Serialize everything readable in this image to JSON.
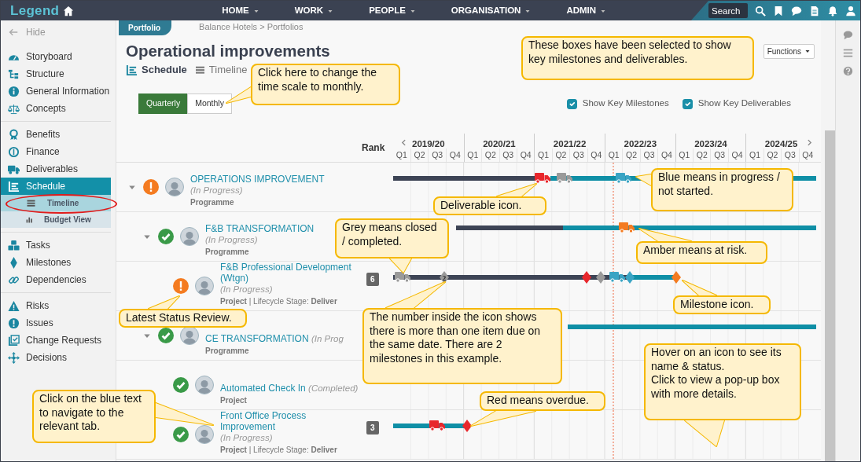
{
  "topbar": {
    "logo": "Legend",
    "menu": [
      {
        "label": "HOME"
      },
      {
        "label": "WORK"
      },
      {
        "label": "PEOPLE"
      },
      {
        "label": "ORGANISATION"
      },
      {
        "label": "ADMIN"
      }
    ],
    "search": {
      "placeholder": "Search"
    }
  },
  "sidebar": {
    "hide": "Hide",
    "groups": [
      {
        "items": [
          {
            "label": "Storyboard",
            "selected": false
          },
          {
            "label": "Structure",
            "selected": false
          },
          {
            "label": "General Information",
            "selected": false
          },
          {
            "label": "Concepts",
            "selected": false
          }
        ]
      },
      {
        "items": [
          {
            "label": "Benefits",
            "selected": false
          },
          {
            "label": "Finance",
            "selected": false
          },
          {
            "label": "Deliverables",
            "selected": false
          },
          {
            "label": "Schedule",
            "selected": true,
            "children": [
              {
                "label": "Timeline",
                "selected": true
              },
              {
                "label": "Budget View",
                "selected": false
              }
            ]
          }
        ]
      },
      {
        "items": [
          {
            "label": "Tasks",
            "selected": false
          },
          {
            "label": "Milestones",
            "selected": false
          },
          {
            "label": "Dependencies",
            "selected": false
          }
        ]
      },
      {
        "items": [
          {
            "label": "Risks",
            "selected": false
          },
          {
            "label": "Issues",
            "selected": false
          },
          {
            "label": "Change Requests",
            "selected": false
          },
          {
            "label": "Decisions",
            "selected": false
          }
        ]
      }
    ]
  },
  "header": {
    "section_tab": "Portfolio",
    "breadcrumb": "Balance Hotels > Portfolios",
    "title": "Operational improvements",
    "functions_button": "Functions",
    "view_tabs": [
      {
        "label": "Schedule",
        "selected": true
      },
      {
        "label": "Timeline",
        "selected": false
      }
    ],
    "scale_toggle": [
      {
        "label": "Quarterly",
        "selected": true
      },
      {
        "label": "Monthly",
        "selected": false
      }
    ],
    "options": [
      {
        "label": "Show Key Milestones",
        "checked": true
      },
      {
        "label": "Show Key Deliverables",
        "checked": true
      }
    ]
  },
  "gantt": {
    "rank_header": "Rank",
    "years": [
      {
        "label": "2019/20",
        "quarters": [
          "Q1",
          "Q2",
          "Q3",
          "Q4"
        ]
      },
      {
        "label": "2020/21",
        "quarters": [
          "Q1",
          "Q2",
          "Q3",
          "Q4"
        ]
      },
      {
        "label": "2021/22",
        "quarters": [
          "Q1",
          "Q2",
          "Q3",
          "Q4"
        ]
      },
      {
        "label": "2022/23",
        "quarters": [
          "Q1",
          "Q2",
          "Q3",
          "Q4"
        ]
      },
      {
        "label": "2023/24",
        "quarters": [
          "Q1",
          "Q2",
          "Q3",
          "Q4"
        ]
      },
      {
        "label": "2024/25",
        "quarters": [
          "Q1",
          "Q2",
          "Q3",
          "Q4"
        ]
      }
    ],
    "rows": [
      {
        "name": "OPERATIONS IMPROVEMENT",
        "state": "(In Progress)",
        "type": "Programme",
        "flagged": true,
        "expanded": true,
        "segments": [
          {
            "color": "#3d4455"
          },
          {
            "color": "#0f8fa6"
          }
        ],
        "markers": [
          {
            "kind": "deliverable",
            "color": "#e8272c"
          },
          {
            "kind": "deliverable",
            "color": "#9a9a9a"
          },
          {
            "kind": "deliverable",
            "color": "#3aa4c4"
          }
        ],
        "children": [
          {
            "name": "F&B TRANSFORMATION",
            "state": "(In Progress)",
            "type": "Programme",
            "flagged": false,
            "expanded": true,
            "segments": [
              {
                "color": "#3d4455"
              },
              {
                "color": "#0f8fa6"
              }
            ],
            "markers": [
              {
                "kind": "deliverable",
                "color": "#f47b20"
              }
            ],
            "children": [
              {
                "name": "F&B Professional Development (Wtgn)",
                "state": "(In Progress)",
                "type": "Project",
                "stage_label": "| Lifecycle Stage:",
                "stage": "Deliver",
                "rank": "6",
                "flagged": true,
                "segments": [
                  {
                    "color": "#3d4455"
                  },
                  {
                    "color": "#0f8fa6"
                  }
                ],
                "markers": [
                  {
                    "kind": "deliverable",
                    "color": "#9a9a9a"
                  },
                  {
                    "kind": "milestone",
                    "color": "#9a9a9a",
                    "count": "2"
                  },
                  {
                    "kind": "milestone",
                    "color": "#e8272c"
                  },
                  {
                    "kind": "milestone",
                    "color": "#9a9a9a"
                  },
                  {
                    "kind": "deliverable",
                    "color": "#3aa4c4"
                  },
                  {
                    "kind": "milestone",
                    "color": "#3aa4c4"
                  },
                  {
                    "kind": "milestone",
                    "color": "#f47b20"
                  }
                ]
              }
            ]
          },
          {
            "name": "CE TRANSFORMATION",
            "state": "(In Prog",
            "type": "Programme",
            "flagged": false,
            "expanded": true,
            "segments": [
              {
                "color": "#0f8fa6"
              }
            ],
            "children": [
              {
                "name": "Automated Check In",
                "state": "(Completed)",
                "type": "Project",
                "flagged": false
              },
              {
                "name": "Front Office Process Improvement",
                "state": "(In Progress)",
                "type": "Project",
                "stage_label": "| Lifecycle Stage:",
                "stage": "Deliver",
                "rank": "3",
                "flagged": false,
                "segments": [
                  {
                    "color": "#0f8fa6"
                  }
                ],
                "markers": [
                  {
                    "kind": "deliverable",
                    "color": "#e8272c"
                  },
                  {
                    "kind": "milestone",
                    "color": "#e8272c"
                  }
                ]
              }
            ]
          }
        ]
      }
    ]
  },
  "annotations": [
    {
      "text": "These boxes have been selected to show key milestones and deliverables."
    },
    {
      "text": "Click here to change the time scale to monthly."
    },
    {
      "text": "Deliverable icon."
    },
    {
      "text": "Blue means in progress / not started."
    },
    {
      "text": "Grey means closed / completed."
    },
    {
      "text": "Amber means at risk."
    },
    {
      "text": "Milestone icon."
    },
    {
      "text": "Latest Status Review."
    },
    {
      "text": "The number inside the icon shows there is more than one item due on the same date.  There are 2 milestones in this example."
    },
    {
      "text": "Click on the blue text to navigate to the relevant tab."
    },
    {
      "text": "Red means overdue."
    },
    {
      "text": "Hover on an icon to see its name & status.\nClick to view a pop-up box with more details."
    }
  ]
}
